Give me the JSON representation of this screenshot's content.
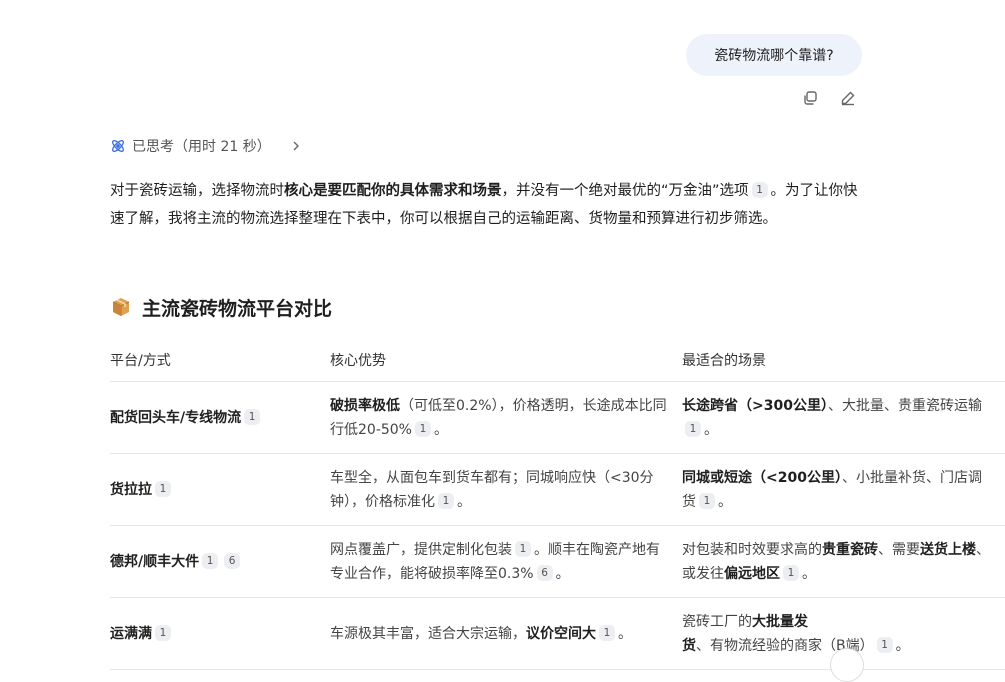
{
  "user_message": "瓷砖物流哪个靠谱?",
  "message_actions": {
    "copy_icon": "copy-icon",
    "edit_icon": "edit-icon"
  },
  "thinking": {
    "label": "已思考（用时 21 秒）",
    "icon": "atom-icon",
    "chevron": "chevron-right-icon"
  },
  "intro": {
    "p1": "对于瓷砖运输，选择物流时",
    "p1_bold": "核心是要匹配你的具体需求和场景",
    "p2": "，并没有一个绝对最优的“万金油”选项",
    "p2_cite": "1",
    "p3": "。为了让你快速了解，我将主流的物流选择整理在下表中，你可以根据自己的运输距离、货物量和预算进行初步筛选。"
  },
  "section": {
    "emoji": "package-icon",
    "title": "主流瓷砖物流平台对比"
  },
  "table": {
    "headers": [
      "平台/方式",
      "核心优势",
      "最适合的场景"
    ],
    "rows": [
      {
        "name": "配货回头车/专线物流",
        "name_cites": [
          "1"
        ],
        "adv_bold": "破损率极低",
        "adv_text": "（可低至0.2%），价格透明，长途成本比同行低20-50%",
        "adv_cite": "1",
        "adv_end": "。",
        "scene_bold": "长途跨省（>300公里）",
        "scene_text": "、大批量、贵重瓷砖运输",
        "scene_cite": "1",
        "scene_end": "。"
      },
      {
        "name": "货拉拉",
        "name_cites": [
          "1"
        ],
        "adv_text": "车型全，从面包车到货车都有；同城响应快（<30分钟），价格标准化",
        "adv_cite": "1",
        "adv_end": "。",
        "scene_bold": "同城或短途（<200公里）",
        "scene_text": "、小批量补货、门店调货",
        "scene_cite": "1",
        "scene_end": "。"
      },
      {
        "name": "德邦/顺丰大件",
        "name_cites": [
          "1",
          "6"
        ],
        "adv_text": "网点覆盖广，提供定制化包装",
        "adv_cite": "1",
        "adv_text2": "。顺丰在陶瓷产地有专业合作，能将破损率降至0.3%",
        "adv_cite2": "6",
        "adv_end": "。",
        "scene_text": "对包装和时效要求高的",
        "scene_bold": "贵重瓷砖",
        "scene_text2": "、需要",
        "scene_bold2": "送货上楼",
        "scene_text3": "、或发往",
        "scene_bold3": "偏远地区",
        "scene_cite": "1",
        "scene_end": "。"
      },
      {
        "name": "运满满",
        "name_cites": [
          "1"
        ],
        "adv_text": "车源极其丰富，适合大宗运输，",
        "adv_bold": "议价空间大",
        "adv_cite": "1",
        "adv_end": "。",
        "scene_text": "瓷砖工厂的",
        "scene_bold": "大批量发货",
        "scene_text2": "、有物流经验的商家（B端）",
        "scene_cite": "1",
        "scene_end": "。"
      }
    ]
  }
}
